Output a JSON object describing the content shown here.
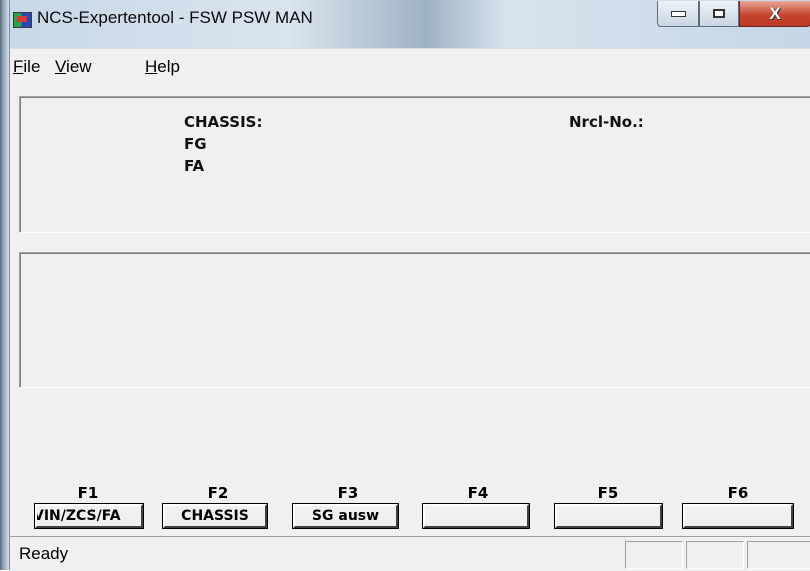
{
  "window": {
    "title": "NCS-Expertentool - FSW PSW MAN",
    "close_symbol": "X"
  },
  "menu": {
    "file": {
      "accel": "F",
      "rest": "ile"
    },
    "view": {
      "accel": "V",
      "rest": "iew"
    },
    "help": {
      "accel": "H",
      "rest": "elp"
    }
  },
  "info": {
    "chassis_label": "CHASSIS:",
    "fg_label": "FG",
    "fa_label": "FA",
    "nrcl_label": "Nrcl-No.:"
  },
  "function_keys": [
    {
      "key": "F1",
      "label": "VIN/ZCS/FA"
    },
    {
      "key": "F2",
      "label": "CHASSIS"
    },
    {
      "key": "F3",
      "label": "SG ausw"
    },
    {
      "key": "F4",
      "label": ""
    },
    {
      "key": "F5",
      "label": ""
    },
    {
      "key": "F6",
      "label": ""
    }
  ],
  "status": {
    "text": "Ready"
  },
  "icons": {
    "app": "ncs-app-icon",
    "minimize": "minimize-icon",
    "maximize": "maximize-icon",
    "close": "close-icon"
  }
}
